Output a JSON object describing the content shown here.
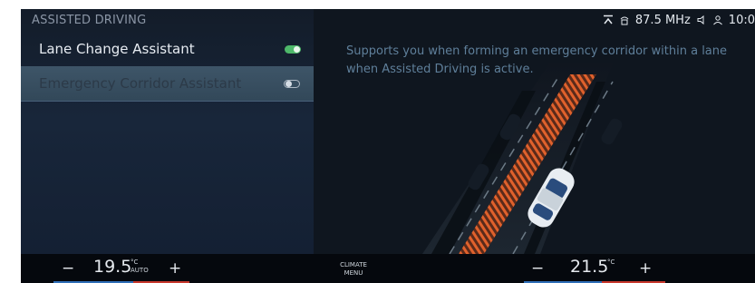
{
  "section": {
    "title": "ASSISTED DRIVING"
  },
  "menu": {
    "items": [
      {
        "label": "Lane Change Assistant",
        "toggle": "on"
      },
      {
        "label": "Emergency Corridor Assistant",
        "toggle": "off"
      }
    ]
  },
  "status": {
    "radio": "87.5 MHz",
    "time": "10:0"
  },
  "description": "Supports you when forming an emergency corridor within a lane when Assisted Driving is active.",
  "climate": {
    "left_minus": "−",
    "left_temp": "19.5",
    "left_unit": "°C",
    "left_mode": "AUTO",
    "left_plus": "+",
    "menu_line1": "CLIMATE",
    "menu_line2": "MENU",
    "right_minus": "−",
    "right_temp": "21.5",
    "right_unit": "°C",
    "right_plus": "+"
  },
  "colors": {
    "toggle_on": "#4eb86a",
    "selected_row": "#3e5568",
    "corridor": "#e0612c"
  }
}
